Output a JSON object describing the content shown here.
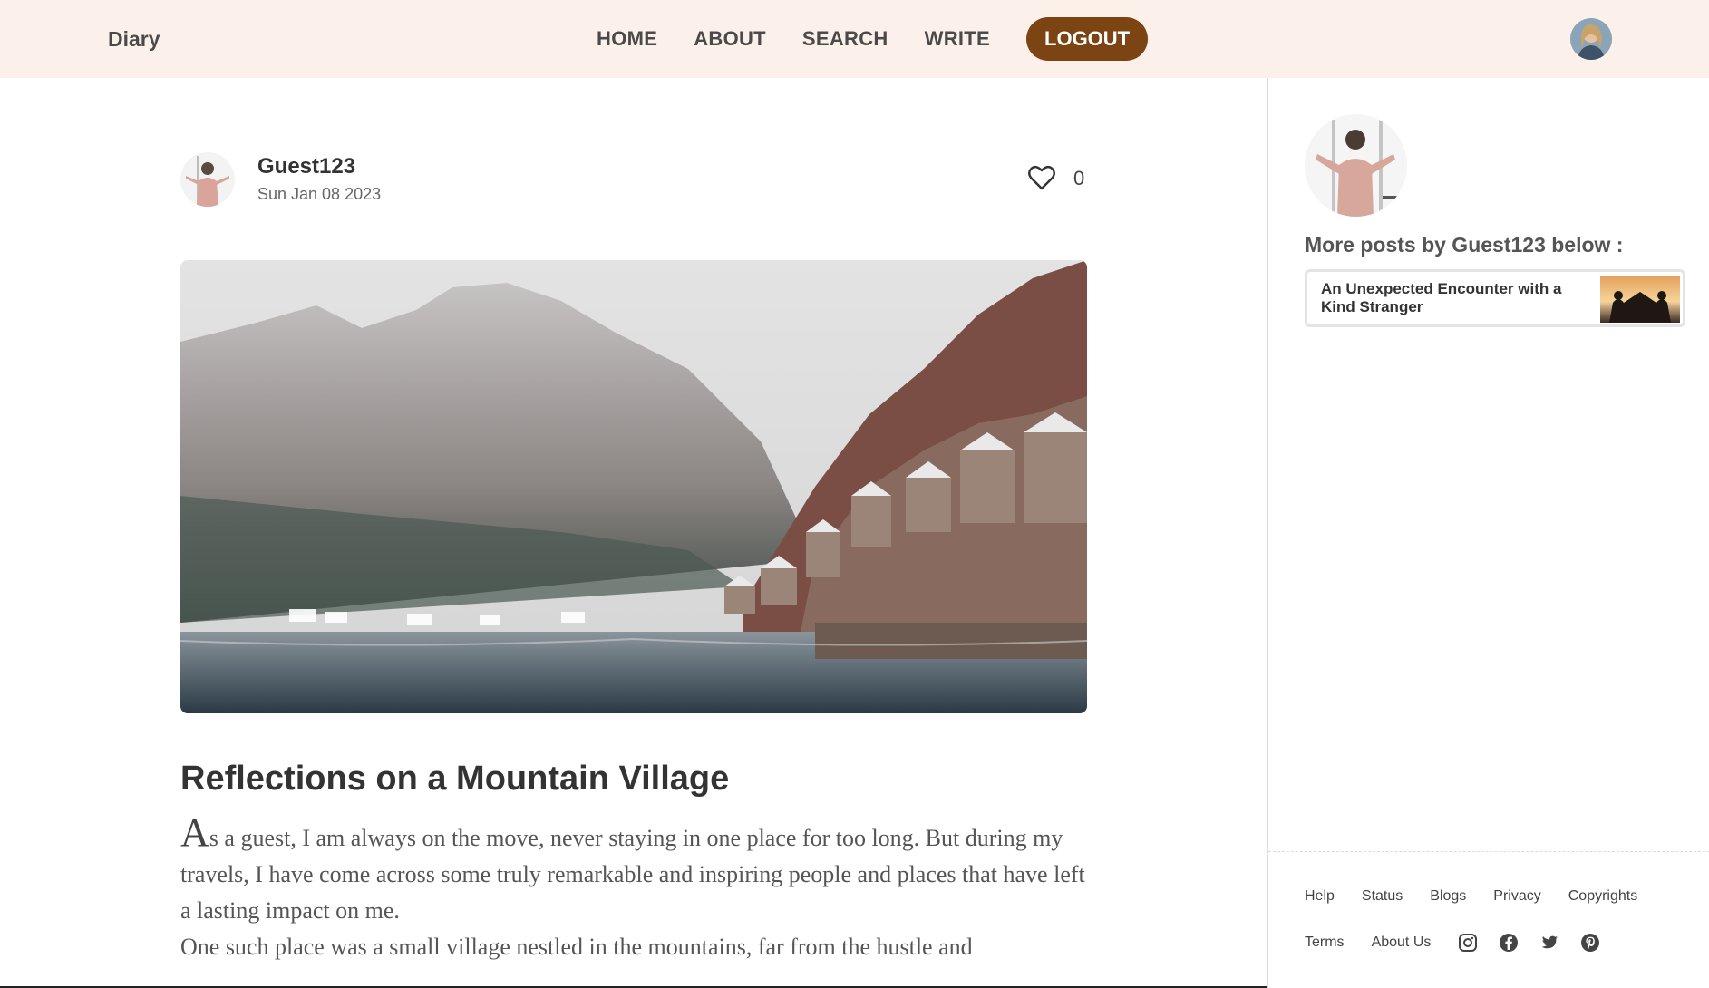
{
  "nav": {
    "brand": "Diary",
    "links": [
      "HOME",
      "ABOUT",
      "SEARCH",
      "WRITE"
    ],
    "logout": "LOGOUT"
  },
  "post": {
    "author": "Guest123",
    "date": "Sun Jan 08 2023",
    "likes": "0",
    "title": "Reflections on a Mountain Village",
    "dropcap": "A",
    "para1_rest": "s a guest, I am always on the move, never staying in one place for too long. But during my travels, I have come across some truly remarkable and inspiring people and places that have left a lasting impact on me.",
    "para2": "One such place was a small village nestled in the mountains, far from the hustle and"
  },
  "sidebar": {
    "more_title": "More posts by Guest123 below :",
    "cards": [
      {
        "title": "An Unexpected Encounter with a Kind Stranger"
      }
    ]
  },
  "footer": {
    "row1": [
      "Help",
      "Status",
      "Blogs",
      "Privacy",
      "Copyrights"
    ],
    "row2": [
      "Terms",
      "About Us"
    ],
    "icons": [
      "instagram-icon",
      "facebook-icon",
      "twitter-icon",
      "pinterest-icon"
    ]
  },
  "colors": {
    "topbar_bg": "#fcf1ea",
    "accent": "#7c4413"
  }
}
